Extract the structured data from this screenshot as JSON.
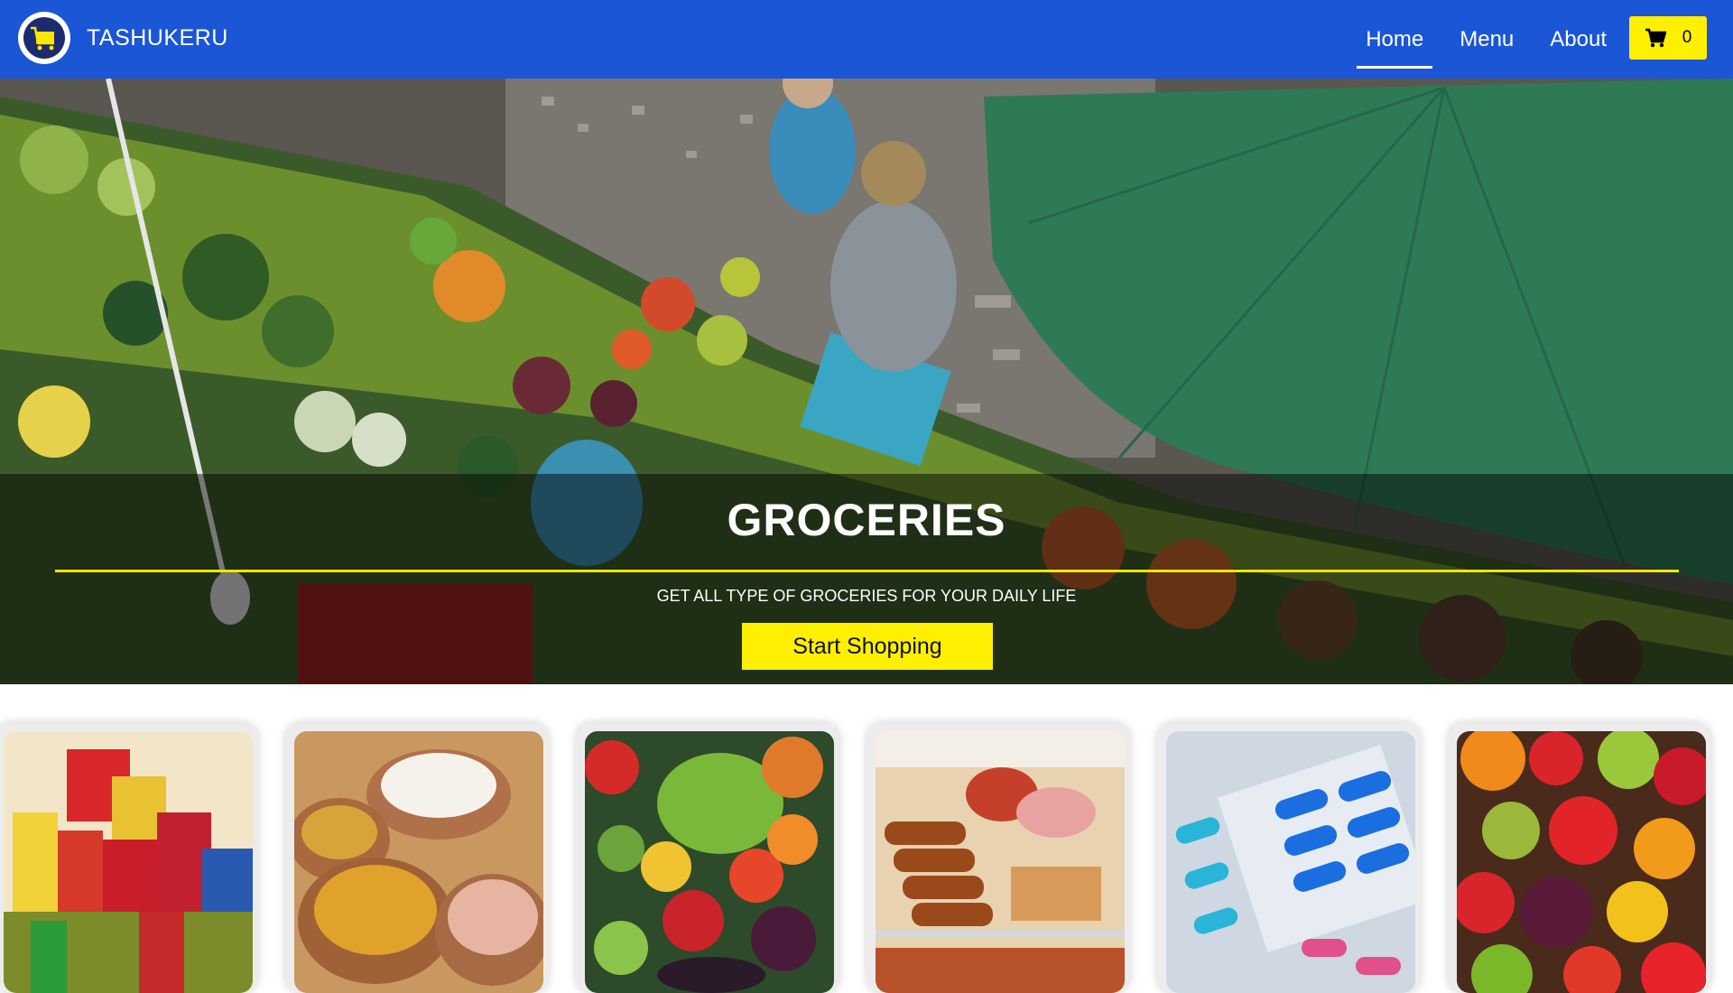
{
  "navbar": {
    "brand": "TASHUKERU",
    "links": [
      {
        "label": "Home",
        "active": true
      },
      {
        "label": "Menu",
        "active": false
      },
      {
        "label": "About",
        "active": false
      }
    ],
    "cart_count": "0"
  },
  "hero": {
    "title": "GROCERIES",
    "subtitle": "GET ALL TYPE OF GROCERIES FOR YOUR DAILY LIFE",
    "button": "Start Shopping"
  },
  "categories": [
    {
      "name": "packaged-groceries"
    },
    {
      "name": "rice-and-lentils"
    },
    {
      "name": "vegetables"
    },
    {
      "name": "bakery"
    },
    {
      "name": "medicines"
    },
    {
      "name": "fruits"
    }
  ],
  "colors": {
    "navbar": "#1a56d6",
    "accent": "#ffef00",
    "hero_line": "#f3e600"
  }
}
